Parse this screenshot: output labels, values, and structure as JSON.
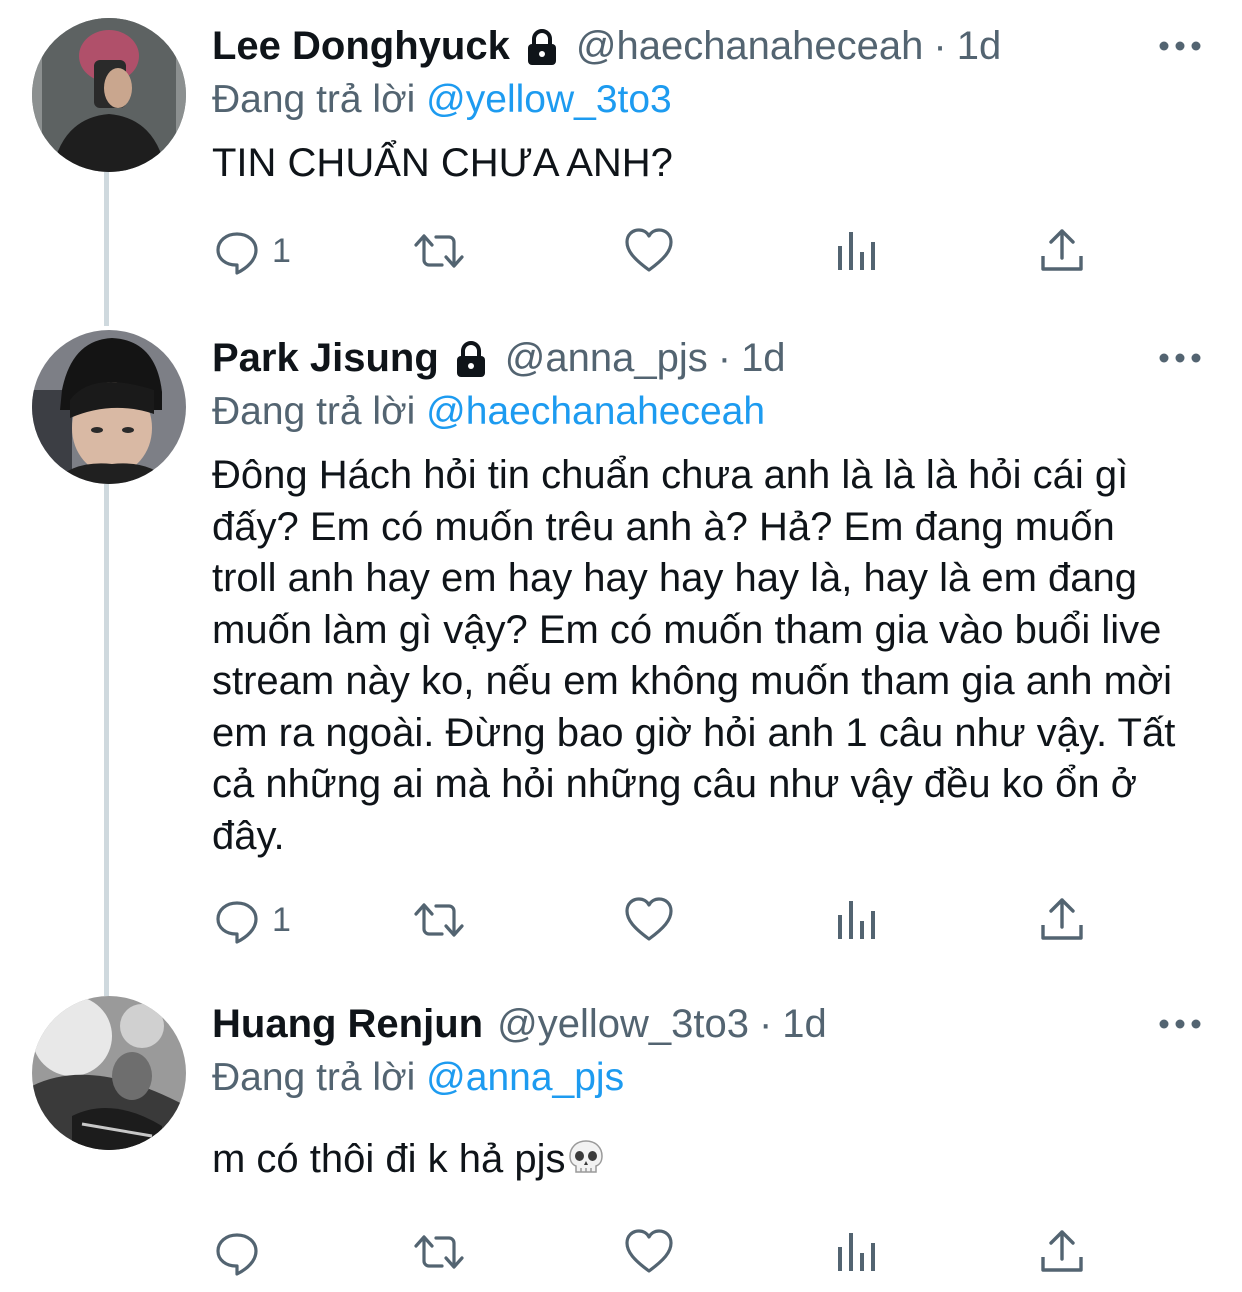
{
  "tweets": [
    {
      "name": "Lee Donghyuck",
      "locked": true,
      "handle": "@haechanaheceah",
      "separator": "·",
      "time": "1d",
      "replying_prefix": "Đang trả lời",
      "replying_to": "@yellow_3to3",
      "text": "TIN CHUẨN CHƯA ANH?",
      "reply_count": "1",
      "icons": [
        "lock-icon",
        "more-icon",
        "reply-icon",
        "retweet-icon",
        "like-icon",
        "analytics-icon",
        "share-icon"
      ]
    },
    {
      "name": "Park Jisung",
      "locked": true,
      "handle": "@anna_pjs",
      "separator": "·",
      "time": "1d",
      "replying_prefix": "Đang trả lời",
      "replying_to": "@haechanaheceah",
      "text": "Đông Hách hỏi tin chuẩn chưa anh là là là hỏi cái gì đấy? Em có muốn trêu anh à? Hả? Em đang muốn troll anh hay em hay hay hay hay là, hay là em đang muốn làm gì vậy? Em có muốn tham gia vào buổi live stream này ko, nếu em không muốn tham gia anh mời em ra ngoài. Đừng bao giờ hỏi anh 1 câu như vậy. Tất cả những ai mà hỏi những câu như vậy đều ko ổn ở đây.",
      "reply_count": "1"
    },
    {
      "name": "Huang Renjun",
      "locked": false,
      "handle": "@yellow_3to3",
      "separator": "·",
      "time": "1d",
      "replying_prefix": "Đang trả lời",
      "replying_to": "@anna_pjs",
      "text": "m có thôi đi k hả pjs",
      "emoji": "skull-emoji",
      "reply_count": ""
    }
  ],
  "colors": {
    "text": "#0f1419",
    "secondary": "#536471",
    "link": "#1d9bf0",
    "thread_line": "#cfd9de"
  }
}
